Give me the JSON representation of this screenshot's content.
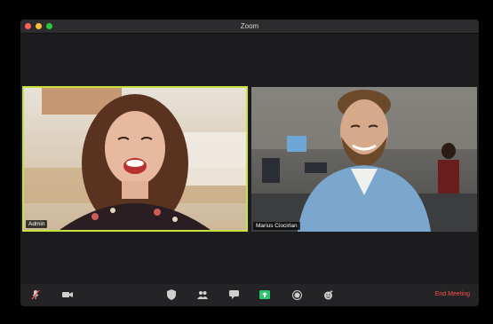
{
  "window": {
    "title": "Zoom"
  },
  "participants": [
    {
      "name": "Admin",
      "active_speaker": true
    },
    {
      "name": "Marius Ciocirlan",
      "active_speaker": false
    }
  ],
  "toolbar": {
    "items": [
      {
        "icon": "microphone-muted-icon"
      },
      {
        "icon": "video-camera-icon"
      },
      {
        "icon": "security-shield-icon"
      },
      {
        "icon": "participants-icon"
      },
      {
        "icon": "chat-icon"
      },
      {
        "icon": "share-screen-icon"
      },
      {
        "icon": "record-icon"
      },
      {
        "icon": "reactions-icon"
      }
    ],
    "end_label": "End Meeting"
  },
  "colors": {
    "active_speaker_border": "#c7e23f",
    "end_meeting": "#ff4b4b",
    "share_screen": "#2dc26b"
  }
}
